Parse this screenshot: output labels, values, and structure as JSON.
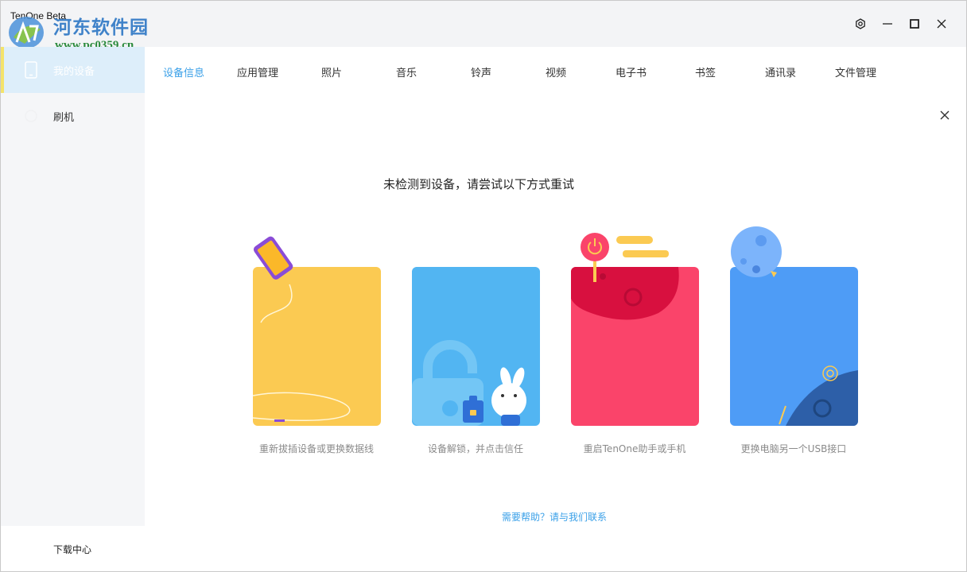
{
  "window": {
    "title": "TenOne Beta"
  },
  "watermark": {
    "name": "河东软件园",
    "url": "www.pc0359.cn"
  },
  "window_controls": [
    "settings-icon",
    "minimize-icon",
    "maximize-icon",
    "close-icon"
  ],
  "sidebar": {
    "items": [
      {
        "label": "我的设备",
        "icon": "phone-icon",
        "active": true
      },
      {
        "label": "刷机",
        "icon": "flash-icon",
        "active": false
      }
    ],
    "footer_label": "下载中心"
  },
  "tabs": [
    {
      "label": "设备信息",
      "active": true
    },
    {
      "label": "应用管理"
    },
    {
      "label": "照片"
    },
    {
      "label": "音乐"
    },
    {
      "label": "铃声"
    },
    {
      "label": "视频"
    },
    {
      "label": "电子书"
    },
    {
      "label": "书签"
    },
    {
      "label": "通讯录"
    },
    {
      "label": "文件管理"
    }
  ],
  "main": {
    "headline": "未检测到设备，请尝试以下方式重试",
    "cards": [
      {
        "label": "重新拔插设备或更换数据线",
        "color": "#fbca52"
      },
      {
        "label": "设备解锁，并点击信任",
        "color": "#52b5f2"
      },
      {
        "label": "重启TenOne助手或手机",
        "color": "#fa446a"
      },
      {
        "label": "更换电脑另一个USB接口",
        "color": "#4e9cf6"
      }
    ],
    "help_link": "需要帮助？请与我们联系"
  },
  "colors": {
    "accent": "#3aa0e8",
    "sidebar_active_bg": "#ddeefa",
    "sidebar_active_bar": "#f4e36b"
  }
}
